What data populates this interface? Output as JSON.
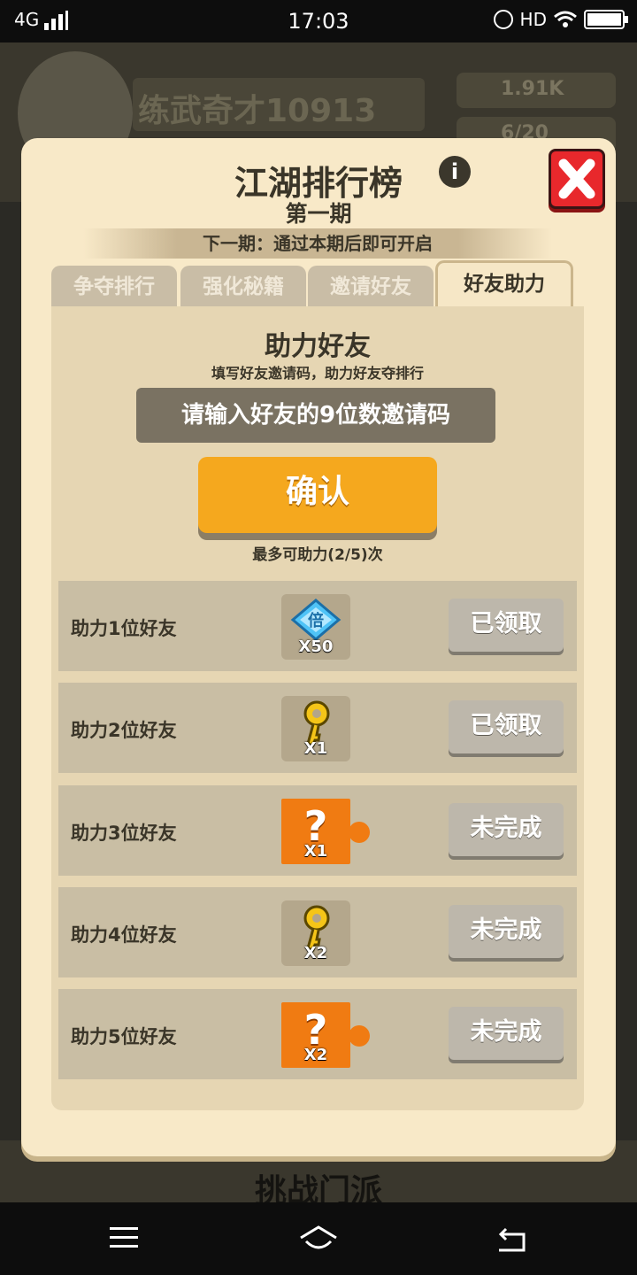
{
  "status_bar": {
    "network": "4G",
    "time": "17:03",
    "hd": "HD"
  },
  "background": {
    "player_name": "练武奇才10913",
    "coins": "1.91K",
    "gems": "6/20",
    "bottom_label": "挑战门派"
  },
  "dialog": {
    "title": "江湖排行榜",
    "subtitle": "第一期",
    "next_period": "下一期：通过本期后即可开启",
    "tabs": [
      {
        "label": "争夺排行",
        "active": false
      },
      {
        "label": "强化秘籍",
        "active": false
      },
      {
        "label": "邀请好友",
        "active": false
      },
      {
        "label": "好友助力",
        "active": true
      }
    ],
    "panel": {
      "title": "助力好友",
      "description": "填写好友邀请码，助力好友夺排行",
      "input_placeholder": "请输入好友的9位数邀请码",
      "confirm_label": "确认",
      "limit_text": "最多可助力(2/5)次"
    },
    "rewards": [
      {
        "label": "助力1位好友",
        "item_icon": "diamond-token-icon",
        "item_text": "倍",
        "quantity": "X50",
        "status": "已领取"
      },
      {
        "label": "助力2位好友",
        "item_icon": "golden-key-icon",
        "quantity": "X1",
        "status": "已领取"
      },
      {
        "label": "助力3位好友",
        "item_icon": "mystery-box-icon",
        "item_text": "?",
        "quantity": "X1",
        "status": "未完成"
      },
      {
        "label": "助力4位好友",
        "item_icon": "golden-key-icon",
        "quantity": "X2",
        "status": "未完成"
      },
      {
        "label": "助力5位好友",
        "item_icon": "mystery-box-icon",
        "item_text": "?",
        "quantity": "X2",
        "status": "未完成"
      }
    ],
    "colors": {
      "accent": "#f5a81e",
      "close": "#e8282c",
      "background": "#f8e9c8"
    }
  }
}
